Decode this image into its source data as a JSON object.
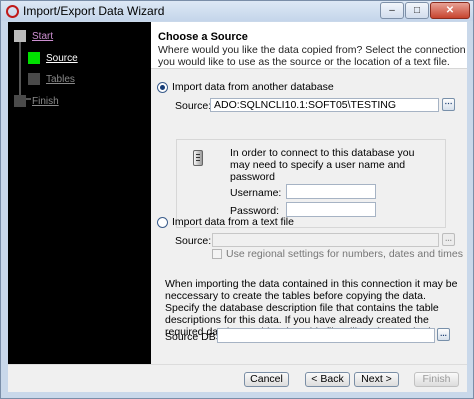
{
  "window": {
    "title": "Import/Export Data Wizard",
    "controls": {
      "minimize": "–",
      "maximize": "□",
      "close": "✕"
    }
  },
  "steps": [
    {
      "label": "Start",
      "state": "done"
    },
    {
      "label": "Source",
      "state": "active"
    },
    {
      "label": "Tables",
      "state": "pending"
    },
    {
      "label": "Finish",
      "state": "pending"
    }
  ],
  "header": {
    "title": "Choose a Source",
    "description": "Where would you like the data copied from? Select the connection you would like to use as the source or the location of a text file."
  },
  "database_option": {
    "label": "Import data from another database",
    "selected": true,
    "source_label": "Source:",
    "source_value": "ADO:SQLNCLI10.1:SOFT05\\TESTING",
    "info_text": "In order to connect to this database you may need to specify a user name and password",
    "username_label": "Username:",
    "username_value": "",
    "password_label": "Password:",
    "password_value": ""
  },
  "text_option": {
    "label": "Import data from a text file",
    "selected": false,
    "source_label": "Source:",
    "source_value": "",
    "browse_label": "...",
    "regional_label": "Use regional settings for numbers, dates and times",
    "regional_checked": false
  },
  "description_file": {
    "note": "When importing the data contained in this connection it may be neccessary to create the tables before copying the data. Specify the database description file that contains the table descriptions for this data. If you have already created the required database tables then this file will not be required.",
    "label": "Source DBS:",
    "value": "",
    "browse_label": "..."
  },
  "buttons": {
    "cancel": "Cancel",
    "back": "< Back",
    "next": "Next >",
    "finish": "Finish"
  },
  "colors": {
    "active_step": "#00e000",
    "done_link": "#cc8fd0",
    "window_frame": "#c9d8ea"
  }
}
